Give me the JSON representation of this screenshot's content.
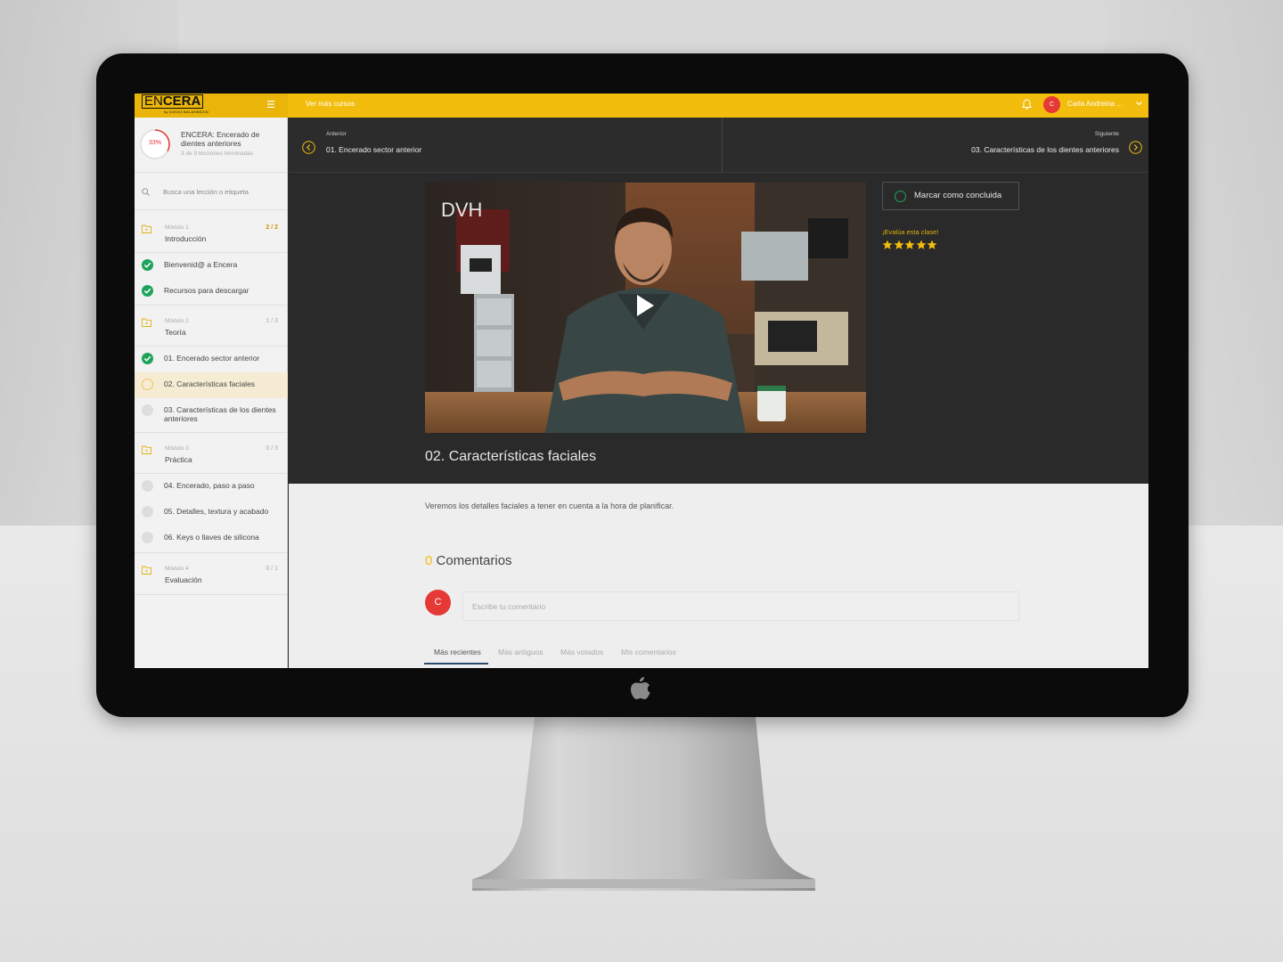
{
  "topbar": {
    "logo_part1": "EN",
    "logo_part2": "CERA",
    "logo_sub": "by DIEGO BALAHBEZIN",
    "link_more_courses": "Ver más cursos",
    "user_initial": "C",
    "user_name": "Carla Andreina ...",
    "accent": "#f2bd0c"
  },
  "course": {
    "progress_percent": 33,
    "progress_label": "33%",
    "title": "ENCERA: Encerado de dientes anteriores",
    "subtitle": "3 de 9 lecciones terminadas"
  },
  "search": {
    "placeholder": "Busca una lección o etiqueta"
  },
  "modules": [
    {
      "label": "Módulo 1",
      "name": "Introducción",
      "count": "2 / 2",
      "lessons": [
        {
          "name": "Bienvenid@ a Encera",
          "status": "done"
        },
        {
          "name": "Recursos para descargar",
          "status": "done"
        }
      ]
    },
    {
      "label": "Módulo 2",
      "name": "Teoría",
      "count": "1 / 3",
      "lessons": [
        {
          "name": "01. Encerado sector anterior",
          "status": "done"
        },
        {
          "name": "02. Características faciales",
          "status": "current"
        },
        {
          "name": "03. Características de los dientes anteriores",
          "status": "pending"
        }
      ]
    },
    {
      "label": "Módulo 3",
      "name": "Práctica",
      "count": "0 / 3",
      "lessons": [
        {
          "name": "04. Encerado, paso a paso",
          "status": "pending"
        },
        {
          "name": "05. Detalles, textura y acabado",
          "status": "pending"
        },
        {
          "name": "06. Keys o llaves de silicona",
          "status": "pending"
        }
      ]
    },
    {
      "label": "Módulo 4",
      "name": "Evaluación",
      "count": "0 / 1",
      "lessons": []
    }
  ],
  "navigation": {
    "prev_label": "Anterior",
    "prev_title": "01. Encerado sector anterior",
    "next_label": "Siguiente",
    "next_title": "03. Características de los dientes anteriores"
  },
  "video": {
    "logo": "DVH",
    "title": "02. Características faciales"
  },
  "actions": {
    "mark_complete": "Marcar como concluida",
    "rate_prompt": "¡Evalúa esta clase!",
    "rating": 5
  },
  "description": "Veremos los detalles faciales a tener en cuenta a la hora de planificar.",
  "comments": {
    "count": "0",
    "heading": "Comentarios",
    "avatar_initial": "C",
    "placeholder": "Escribe tu comentario",
    "tabs": [
      "Más recientes",
      "Más antiguos",
      "Más votados",
      "Mis comentarios"
    ]
  }
}
